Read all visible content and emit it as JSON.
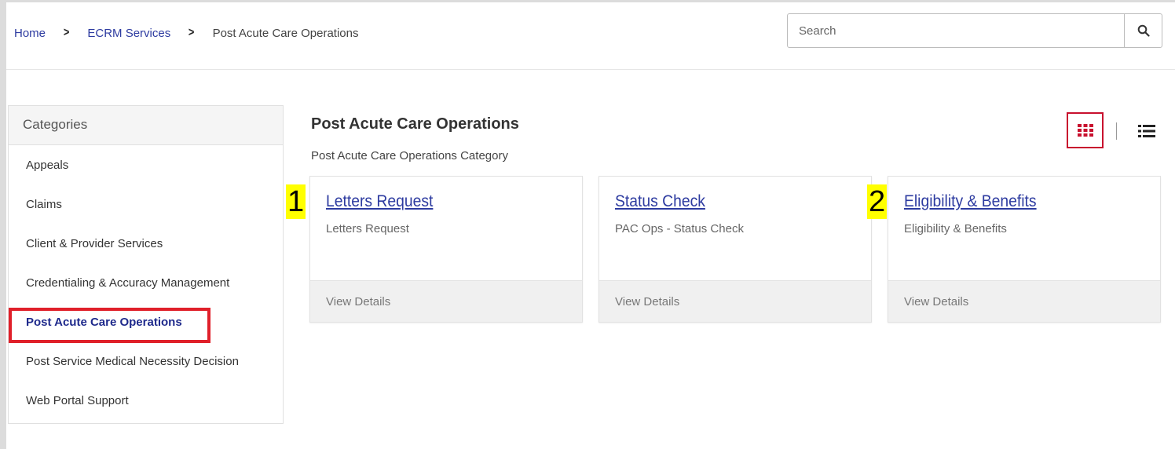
{
  "breadcrumb": {
    "items": [
      "Home",
      "ECRM Services"
    ],
    "current": "Post Acute Care Operations"
  },
  "search": {
    "placeholder": "Search",
    "icon": "search-icon"
  },
  "sidebar": {
    "header": "Categories",
    "items": [
      {
        "label": "Appeals",
        "active": false
      },
      {
        "label": "Claims",
        "active": false
      },
      {
        "label": "Client & Provider Services",
        "active": false
      },
      {
        "label": "Credentialing & Accuracy Management",
        "active": false
      },
      {
        "label": "Post Acute Care Operations",
        "active": true
      },
      {
        "label": "Post Service Medical Necessity Decision",
        "active": false
      },
      {
        "label": "Web Portal Support",
        "active": false
      }
    ]
  },
  "main": {
    "title": "Post Acute Care Operations",
    "subtitle": "Post Acute Care Operations Category",
    "view_toggle": {
      "grid_icon": "grid-view-icon",
      "list_icon": "list-view-icon",
      "selected": "grid"
    },
    "cards": [
      {
        "title": "Letters Request",
        "description": "Letters Request",
        "footer": "View Details",
        "annotation": "1"
      },
      {
        "title": "Status Check",
        "description": "PAC Ops - Status Check",
        "footer": "View Details",
        "annotation": ""
      },
      {
        "title": "Eligibility & Benefits",
        "description": "Eligibility & Benefits",
        "footer": "View Details",
        "annotation": "2"
      }
    ]
  },
  "colors": {
    "link": "#2d3ba0",
    "highlight_red": "#e0202a",
    "annotation_yellow": "#ffff00"
  }
}
